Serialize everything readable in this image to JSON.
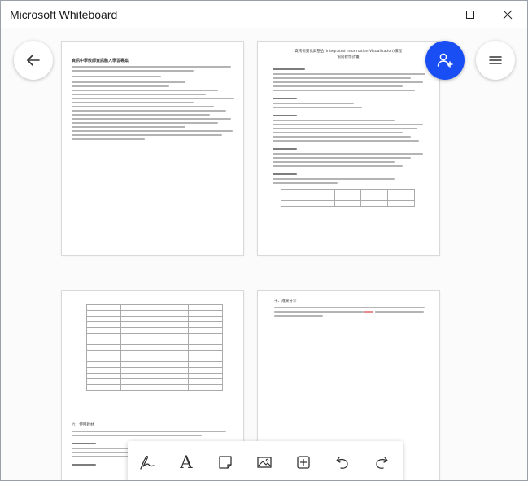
{
  "app": {
    "title": "Microsoft Whiteboard"
  },
  "window_controls": {
    "minimize": "minimize-icon",
    "maximize": "maximize-icon",
    "close": "close-icon"
  },
  "nav": {
    "back_icon": "arrow-left-icon",
    "invite_icon": "add-person-icon",
    "menu_icon": "hamburger-menu-icon"
  },
  "colors": {
    "accent": "#1a4ef5",
    "canvas": "#fbfbfb"
  },
  "pages": {
    "p1": {
      "title": "資訊中學教師資訊融入學習專案"
    },
    "p2": {
      "title_line1": "資訊視覺化與整合(Integrated Information Visualization)課程",
      "title_line2": "協同教學計畫"
    },
    "p3": {
      "footer_heading": "六、使用教材"
    },
    "p4": {
      "heading": "十、成果分享"
    }
  },
  "toolbar": {
    "tools": [
      {
        "name": "pen-tool",
        "icon": "pen-icon"
      },
      {
        "name": "text-tool",
        "icon": "text-icon",
        "label": "A"
      },
      {
        "name": "sticky-note-tool",
        "icon": "sticky-note-icon"
      },
      {
        "name": "image-tool",
        "icon": "image-icon"
      },
      {
        "name": "add-tool",
        "icon": "plus-box-icon"
      },
      {
        "name": "undo-tool",
        "icon": "undo-icon"
      },
      {
        "name": "redo-tool",
        "icon": "redo-icon"
      }
    ]
  }
}
